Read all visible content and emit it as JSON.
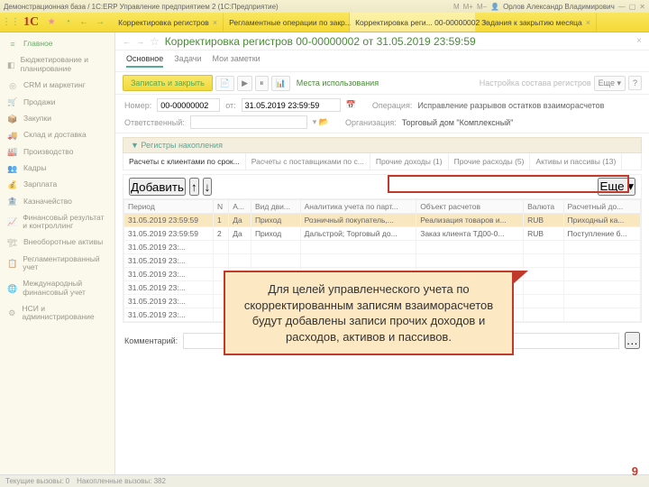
{
  "window": {
    "title": "Демонстрационная база / 1С:ERP Управление предприятием 2 (1С:Предприятие)",
    "user": "Орлов Александр Владимирович"
  },
  "tabs": [
    {
      "label": "Корректировка регистров"
    },
    {
      "label": "Регламентные операции по закр..."
    },
    {
      "label": "Корректировка реги... 00-00000002",
      "active": true
    },
    {
      "label": "Задания к закрытию месяца"
    }
  ],
  "sidebar": [
    {
      "label": "Главное",
      "sel": true
    },
    {
      "label": "Бюджетирование и планирование"
    },
    {
      "label": "CRM и маркетинг"
    },
    {
      "label": "Продажи"
    },
    {
      "label": "Закупки"
    },
    {
      "label": "Склад и доставка"
    },
    {
      "label": "Производство"
    },
    {
      "label": "Кадры"
    },
    {
      "label": "Зарплата"
    },
    {
      "label": "Казначейство"
    },
    {
      "label": "Финансовый результат и контроллинг"
    },
    {
      "label": "Внеоборотные активы"
    },
    {
      "label": "Регламентированный учет"
    },
    {
      "label": "Международный финансовый учет"
    },
    {
      "label": "НСИ и администрирование"
    }
  ],
  "page": {
    "title": "Корректировка регистров 00-00000002 от 31.05.2019 23:59:59",
    "subtabs": {
      "a": "Основное",
      "b": "Задачи",
      "c": "Мои заметки"
    },
    "toolbar": {
      "save": "Записать и закрыть",
      "places": "Места использования",
      "settings": "Настройка состава регистров",
      "more": "Еще"
    },
    "form": {
      "num_l": "Номер:",
      "num": "00-00000002",
      "ot": "от:",
      "date": "31.05.2019 23:59:59",
      "op_l": "Операция:",
      "op": "Исправление разрывов остатков взаиморасчетов",
      "resp_l": "Ответственный:",
      "org_l": "Организация:",
      "org": "Торговый дом \"Комплексный\""
    },
    "section": "Регистры накопления",
    "regtabs": [
      "Расчеты с клиентами по срок...",
      "Расчеты с поставщиками по с...",
      "Прочие доходы (1)",
      "Прочие расходы (5)",
      "Активы и пассивы (13)"
    ],
    "tbl": {
      "add": "Добавить",
      "more": "Еще",
      "cols": [
        "Период",
        "N",
        "А...",
        "Вид дви...",
        "Аналитика учета по парт...",
        "Объект расчетов",
        "Валюта",
        "Расчетный до..."
      ],
      "rows": [
        [
          "31.05.2019 23:59:59",
          "1",
          "Да",
          "Приход",
          "Розничный покупатель,...",
          "Реализация товаров и...",
          "RUB",
          "Приходный ка..."
        ],
        [
          "31.05.2019 23:59:59",
          "2",
          "Да",
          "Приход",
          "Дальстрой; Торговый до...",
          "Заказ клиента ТД00-0...",
          "RUB",
          "Поступление б..."
        ],
        [
          "31.05.2019 23:...",
          "",
          "",
          "",
          "",
          "",
          "",
          ""
        ],
        [
          "31.05.2019 23:...",
          "",
          "",
          "",
          "",
          "",
          "",
          ""
        ],
        [
          "31.05.2019 23:...",
          "",
          "",
          "",
          "",
          "",
          "",
          ""
        ],
        [
          "31.05.2019 23:...",
          "",
          "",
          "",
          "",
          "",
          "",
          ""
        ],
        [
          "31.05.2019 23:...",
          "",
          "",
          "",
          "",
          "",
          "",
          ""
        ],
        [
          "31.05.2019 23:...",
          "",
          "",
          "",
          "",
          "",
          "",
          ""
        ]
      ]
    },
    "comment_l": "Комментарий:"
  },
  "callout": "Для целей управленческого учета по скорректированным записям взаиморасчетов будут добавлены записи прочих доходов и расходов, активов и пассивов.",
  "status": {
    "a": "Текущие вызовы: 0",
    "b": "Накопленные вызовы: 382"
  },
  "slide": "9"
}
